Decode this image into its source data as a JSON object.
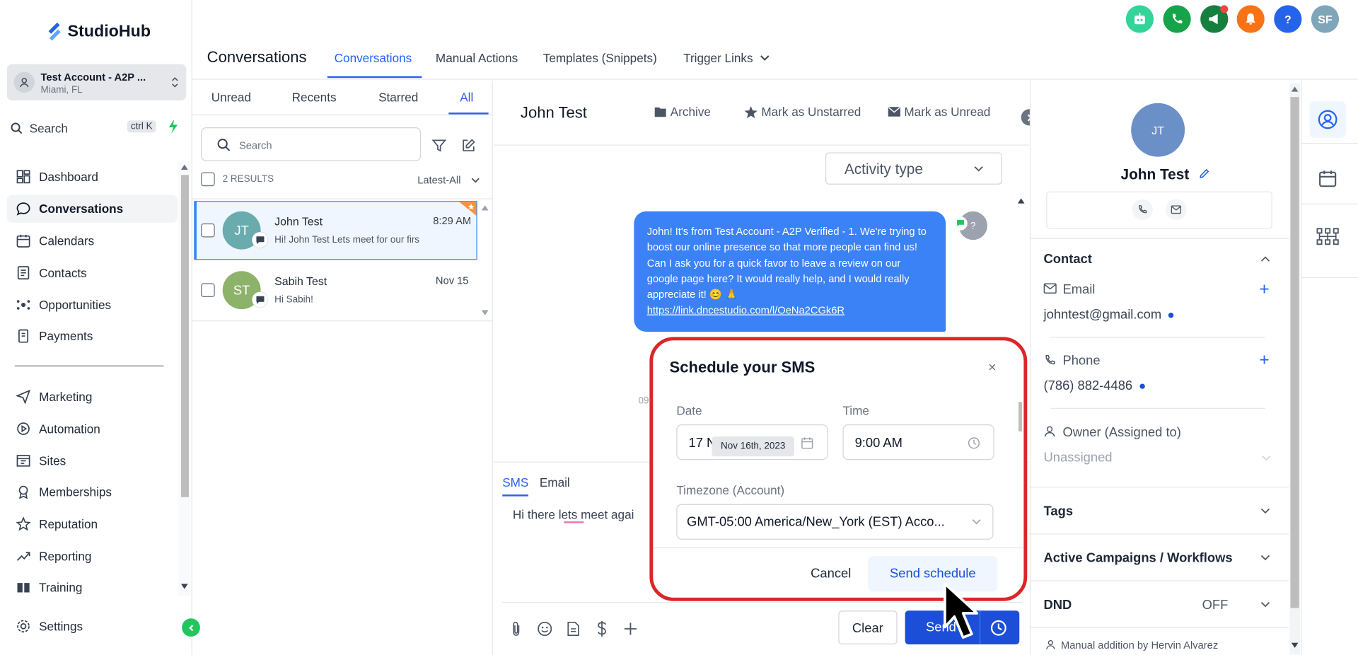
{
  "app": {
    "name": "StudioHub"
  },
  "account": {
    "name": "Test Account - A2P ...",
    "location": "Miami, FL"
  },
  "sidebar": {
    "search_label": "Search",
    "search_shortcut": "ctrl K",
    "items": [
      {
        "label": "Dashboard",
        "icon": "dashboard-icon"
      },
      {
        "label": "Conversations",
        "icon": "chat-icon",
        "active": true
      },
      {
        "label": "Calendars",
        "icon": "calendar-icon"
      },
      {
        "label": "Contacts",
        "icon": "contacts-icon"
      },
      {
        "label": "Opportunities",
        "icon": "opportunities-icon"
      },
      {
        "label": "Payments",
        "icon": "payments-icon"
      },
      {
        "label": "Marketing",
        "icon": "send-icon"
      },
      {
        "label": "Automation",
        "icon": "automation-icon"
      },
      {
        "label": "Sites",
        "icon": "sites-icon"
      },
      {
        "label": "Memberships",
        "icon": "memberships-icon"
      },
      {
        "label": "Reputation",
        "icon": "star-icon"
      },
      {
        "label": "Reporting",
        "icon": "trend-icon"
      },
      {
        "label": "Training",
        "icon": "book-icon"
      }
    ],
    "settings_label": "Settings"
  },
  "header": {
    "title": "Conversations",
    "tabs": [
      "Conversations",
      "Manual Actions",
      "Templates (Snippets)",
      "Trigger Links"
    ],
    "user_initials": "SF",
    "help_label": "?"
  },
  "list": {
    "filters": [
      "Unread",
      "Recents",
      "Starred",
      "All"
    ],
    "search_placeholder": "Search",
    "results": "2 RESULTS",
    "sort": "Latest-All",
    "conversations": [
      {
        "initials": "JT",
        "name": "John Test",
        "time": "8:29 AM",
        "preview": "Hi! John Test Lets meet for our firs",
        "color": "#6aabad"
      },
      {
        "initials": "ST",
        "name": "Sabih Test",
        "time": "Nov 15",
        "preview": "Hi Sabih!",
        "color": "#8cb369"
      }
    ]
  },
  "conversation": {
    "contact_name": "John Test",
    "actions": [
      "Archive",
      "Mark as Unstarred",
      "Mark as Unread"
    ],
    "activity_type": "Activity type",
    "message": "John! It's  from Test Account - A2P Verified - 1. We're trying to boost our online presence so that more people can find us! Can I ask you for a quick favor to leave a review on our google page here? It would really help, and I would really appreciate it! 😊 🙏",
    "message_link": "https://link.dncestudio.com/l/OeNa2CGk6R",
    "sender_initial": "?",
    "partial_time": "09",
    "composer_tabs": [
      "SMS",
      "Email"
    ],
    "composer_text": "Hi there lets meet agai",
    "clear_label": "Clear",
    "send_label": "Send"
  },
  "modal": {
    "title": "Schedule your SMS",
    "close": "×",
    "date_label": "Date",
    "date_value": "17 N",
    "date_tooltip": "Nov 16th, 2023",
    "time_label": "Time",
    "time_value": "9:00 AM",
    "tz_label": "Timezone (Account)",
    "tz_value": "GMT-05:00 America/New_York (EST) Acco...",
    "cancel": "Cancel",
    "send": "Send schedule",
    "highlight_color": "#dc2626"
  },
  "contact": {
    "initials": "JT",
    "name": "John Test",
    "section_contact": "Contact",
    "email_label": "Email",
    "email": "johntest@gmail.com",
    "phone_label": "Phone",
    "phone": "(786) 882-4486",
    "owner_label": "Owner (Assigned to)",
    "owner": "Unassigned",
    "tags": "Tags",
    "campaigns": "Active Campaigns / Workflows",
    "dnd": "DND",
    "dnd_value": "OFF",
    "note": "Manual addition by Hervin Alvarez"
  }
}
